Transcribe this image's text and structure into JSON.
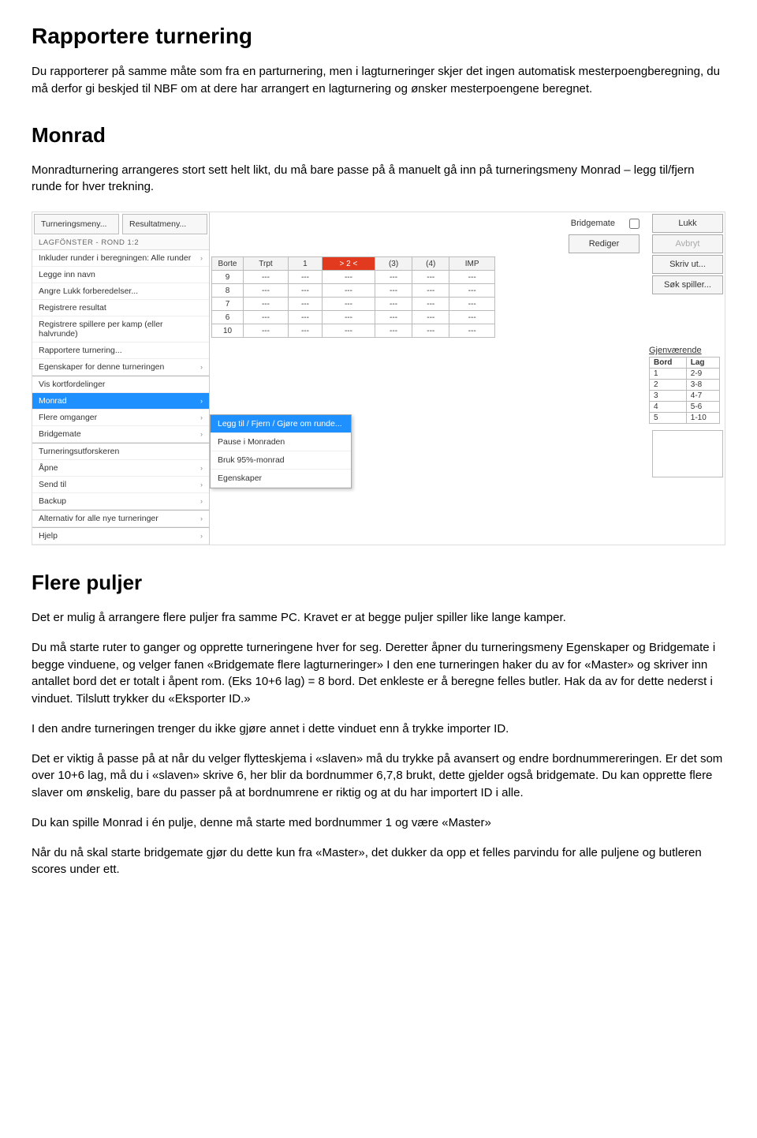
{
  "doc": {
    "h1": "Rapportere turnering",
    "p1": "Du rapporterer på samme måte som fra en parturnering, men i lagturneringer skjer det ingen automatisk mesterpoengberegning, du må derfor gi beskjed til NBF om at dere har arrangert en lagturnering og ønsker mesterpoengene beregnet.",
    "h2a": "Monrad",
    "p2": "Monradturnering arrangeres stort sett helt likt, du må bare passe på å manuelt gå inn på turneringsmeny Monrad – legg til/fjern runde for hver trekning.",
    "h2b": "Flere puljer",
    "p3": "Det er mulig å arrangere flere puljer fra samme PC. Kravet er at begge puljer spiller like lange kamper.",
    "p4": "Du må starte ruter to ganger og opprette turneringene hver for seg. Deretter åpner du turneringsmeny Egenskaper og Bridgemate i begge vinduene, og velger fanen «Bridgemate flere lagturneringer» I den ene turneringen haker du av for «Master» og skriver inn antallet bord det er totalt i åpent rom. (Eks 10+6 lag) = 8 bord. Det enkleste er å beregne felles butler. Hak da av for dette nederst i vinduet. Tilslutt trykker du «Eksporter ID.»",
    "p5": "I den andre turneringen trenger du ikke gjøre annet i dette vinduet enn å trykke importer ID.",
    "p6": "Det er viktig å passe på at når du velger flytteskjema i «slaven» må du trykke på avansert og endre bordnummereringen. Er det som over 10+6 lag, må du i «slaven» skrive 6, her blir da bordnummer 6,7,8 brukt, dette gjelder også bridgemate. Du kan opprette flere slaver om ønskelig, bare du passer på at bordnumrene er riktig og at du har importert ID i alle.",
    "p7": "Du kan spille Monrad i én pulje, denne må starte med bordnummer 1 og være «Master»",
    "p8": "Når du nå skal starte bridgemate gjør du dette kun fra «Master», det dukker da opp et felles parvindu for alle puljene og butleren scores under ett."
  },
  "ss": {
    "topButtons": {
      "left": "Turneringsmeny...",
      "right": "Resultatmeny..."
    },
    "winTitle": "LAGFÖNSTER - ROND 1:2",
    "inkluder": "Inkluder runder i beregningen:  Alle runder",
    "menu": [
      {
        "label": "Legge inn navn",
        "arrow": false
      },
      {
        "label": "Angre Lukk forberedelser...",
        "arrow": false
      },
      {
        "label": "Registrere resultat",
        "arrow": false
      },
      {
        "label": "Registrere spillere per kamp (eller halvrunde)",
        "arrow": false
      },
      {
        "label": "Rapportere turnering...",
        "arrow": false
      },
      {
        "label": "Egenskaper for denne turneringen",
        "arrow": true
      },
      {
        "label": "Vis kortfordelinger",
        "arrow": false,
        "sep": true
      },
      {
        "label": "Monrad",
        "arrow": true,
        "hl": true
      },
      {
        "label": "Flere omganger",
        "arrow": true
      },
      {
        "label": "Bridgemate",
        "arrow": true
      },
      {
        "label": "Turneringsutforskeren",
        "arrow": false,
        "sep": true
      },
      {
        "label": "Åpne",
        "arrow": true
      },
      {
        "label": "Send til",
        "arrow": true
      },
      {
        "label": "Backup",
        "arrow": true
      },
      {
        "label": "Alternativ for alle nye turneringer",
        "arrow": true,
        "sep": true
      },
      {
        "label": "Hjelp",
        "arrow": true,
        "sep": true
      }
    ],
    "submenu": [
      {
        "label": "Legg til / Fjern / Gjøre om runde...",
        "hl": true
      },
      {
        "label": "Pause i Monraden"
      },
      {
        "label": "Bruk 95%-monrad"
      },
      {
        "label": "Egenskaper"
      }
    ],
    "bmLabel": "Bridgemate",
    "buttons": {
      "lukk": "Lukk",
      "avbryt": "Avbryt",
      "rediger": "Rediger",
      "skriv": "Skriv ut...",
      "sok": "Søk spiller..."
    },
    "table": {
      "headers": [
        "Borte",
        "Trpt",
        "1",
        "> 2 <",
        "(3)",
        "(4)",
        "IMP"
      ],
      "rows": [
        [
          "9",
          "---",
          "---",
          "---",
          "---",
          "---",
          "---"
        ],
        [
          "8",
          "---",
          "---",
          "---",
          "---",
          "---",
          "---"
        ],
        [
          "7",
          "---",
          "---",
          "---",
          "---",
          "---",
          "---"
        ],
        [
          "6",
          "---",
          "---",
          "---",
          "---",
          "---",
          "---"
        ],
        [
          "10",
          "---",
          "---",
          "---",
          "---",
          "---",
          "---"
        ]
      ]
    },
    "remaining": {
      "title": "Gjenværende",
      "headers": [
        "Bord",
        "Lag"
      ],
      "rows": [
        [
          "1",
          "2-9"
        ],
        [
          "2",
          "3-8"
        ],
        [
          "3",
          "4-7"
        ],
        [
          "4",
          "5-6"
        ],
        [
          "5",
          "1-10"
        ]
      ]
    }
  }
}
